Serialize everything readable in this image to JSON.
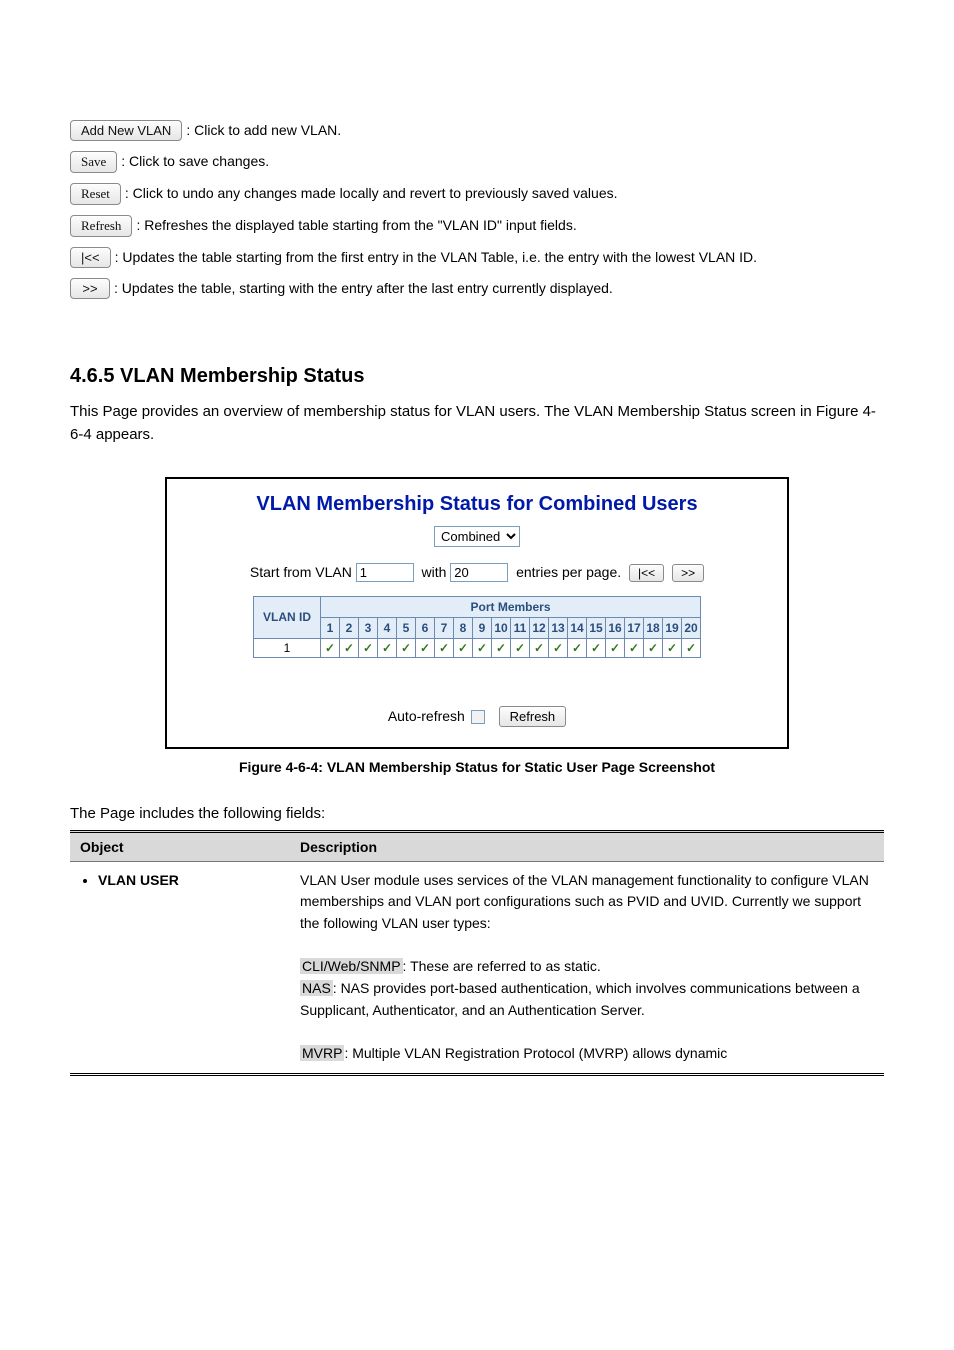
{
  "buttons": {
    "add_new_vlan": {
      "label": "Add New VLAN",
      "desc": ": Click to add new VLAN."
    },
    "save": {
      "label": "Save",
      "desc": ": Click to save changes."
    },
    "reset": {
      "label": "Reset",
      "desc": ": Click to undo any changes made locally and revert to previously saved values."
    },
    "refresh": {
      "label": "Refresh",
      "desc": ": Refreshes the displayed table starting from the \"VLAN ID\" input fields."
    },
    "first": {
      "label": "|<<",
      "desc": ": Updates the table starting from the first entry in the VLAN Table, i.e. the entry with the lowest VLAN ID."
    },
    "next": {
      "label": ">>",
      "desc": ": Updates the table, starting with the entry after the last entry currently displayed."
    }
  },
  "section": {
    "number": "4.6.5 VLAN Membership Status",
    "body": "This Page provides an overview of membership status for VLAN users. The VLAN Membership Status screen in Figure 4-6-4 appears."
  },
  "figure": {
    "title": "VLAN Membership Status for Combined Users",
    "select_value": "Combined",
    "start_label": "Start from VLAN",
    "start_value": "1",
    "with_label": "with",
    "with_value": "20",
    "entries_label": "entries per page.",
    "first_btn": "|<<",
    "next_btn": ">>",
    "port_members_header": "Port Members",
    "vlan_id_header": "VLAN ID",
    "ports": [
      "1",
      "2",
      "3",
      "4",
      "5",
      "6",
      "7",
      "8",
      "9",
      "10",
      "11",
      "12",
      "13",
      "14",
      "15",
      "16",
      "17",
      "18",
      "19",
      "20"
    ],
    "row_vlan_id": "1",
    "auto_refresh_label": "Auto-refresh",
    "refresh_btn": "Refresh",
    "caption": "Figure 4-6-4: VLAN Membership Status for Static User Page Screenshot"
  },
  "desc_intro": "The Page includes the following fields:",
  "desc_table": {
    "h_object": "Object",
    "h_desc": "Description",
    "row1_object": "VLAN USER",
    "row1_text_a": "VLAN User module uses services of the VLAN management functionality to configure VLAN memberships and VLAN port configurations such as PVID and UVID. Currently we support the following VLAN user types:",
    "row1_cli_web_label": "CLI/Web/SNMP",
    "row1_cli_web_text": ": These are referred to as static.",
    "row1_nas_label": "NAS",
    "row1_nas_text": ": NAS provides port-based authentication, which involves communications between a Supplicant, Authenticator, and an Authentication Server.",
    "row1_mvrp_label": "MVRP",
    "row1_mvrp_text": ": Multiple VLAN Registration Protocol (MVRP) allows dynamic"
  }
}
